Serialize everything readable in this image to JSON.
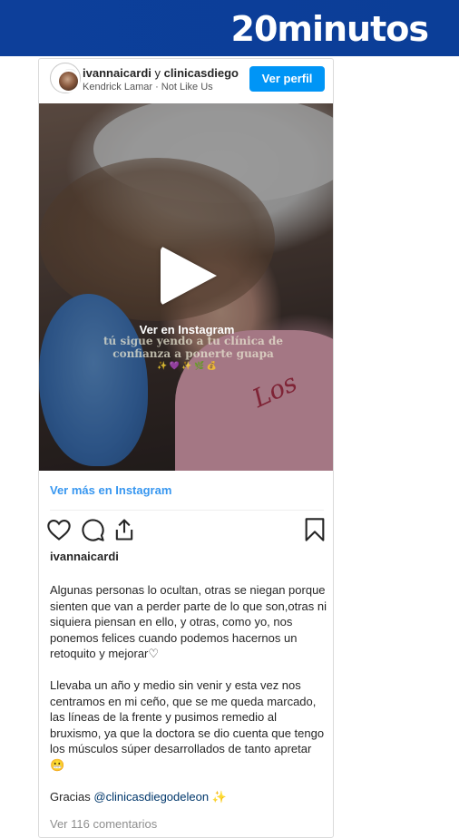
{
  "brand": {
    "logo": "20minutos"
  },
  "post": {
    "author": "ivannaicardi",
    "connector": "y",
    "collaborator": "clinicasdiego",
    "song": "Kendrick Lamar · Not Like Us",
    "profile_button": "Ver perfil",
    "media": {
      "overlay_label": "Ver en Instagram",
      "overlay_caption": "tú sigue yendo a tu clínica de confianza a ponerte guapa",
      "overlay_emojis": "✨ 💜 ✨ 🌿 💰",
      "shirt_text": "Los"
    },
    "see_more": "Ver más en Instagram",
    "icons": [
      "heart-icon",
      "comment-icon",
      "share-icon",
      "bookmark-icon"
    ],
    "username_line": "ivannaicardi",
    "caption_p1": "Algunas personas lo ocultan, otras se niegan porque sienten que van a perder parte de lo que son,otras ni siquiera piensan en ello, y otras, como yo, nos ponemos felices cuando podemos hacernos un retoquito y mejorar♡",
    "caption_p2": "Llevaba un año y medio sin venir y esta vez nos centramos en mi ceño, que se me queda marcado, las líneas de la frente y pusimos remedio al bruxismo, ya que la doctora se dio cuenta que tengo los músculos súper desarrollados de tanto apretar 😬",
    "caption_p3_prefix": "Gracias ",
    "caption_p3_mention": "@clinicasdiegodeleon",
    "caption_p3_suffix": " ✨",
    "comments_link": "Ver 116 comentarios"
  }
}
